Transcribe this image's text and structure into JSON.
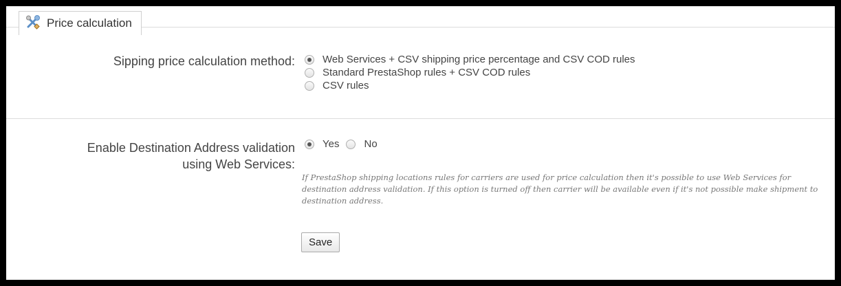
{
  "panel": {
    "legend": "Price calculation",
    "icon": "tools-icon"
  },
  "shipping_method": {
    "label": "Sipping price calculation method:",
    "options": [
      {
        "label": "Web Services + CSV shipping price percentage and CSV COD rules",
        "checked": true
      },
      {
        "label": "Standard PrestaShop rules + CSV COD rules",
        "checked": false
      },
      {
        "label": "CSV rules",
        "checked": false
      }
    ]
  },
  "address_validation": {
    "label_line1": "Enable Destination Address validation",
    "label_line2": "using Web Services:",
    "yes_label": "Yes",
    "no_label": "No",
    "selected": "Yes",
    "help": "If PrestaShop shipping locations rules for carriers are used for price calculation then it's possible to use Web Services for destination address validation. If this option is turned off then carrier will be available even if it's not possible make shipment to destination address."
  },
  "actions": {
    "save_label": "Save"
  }
}
